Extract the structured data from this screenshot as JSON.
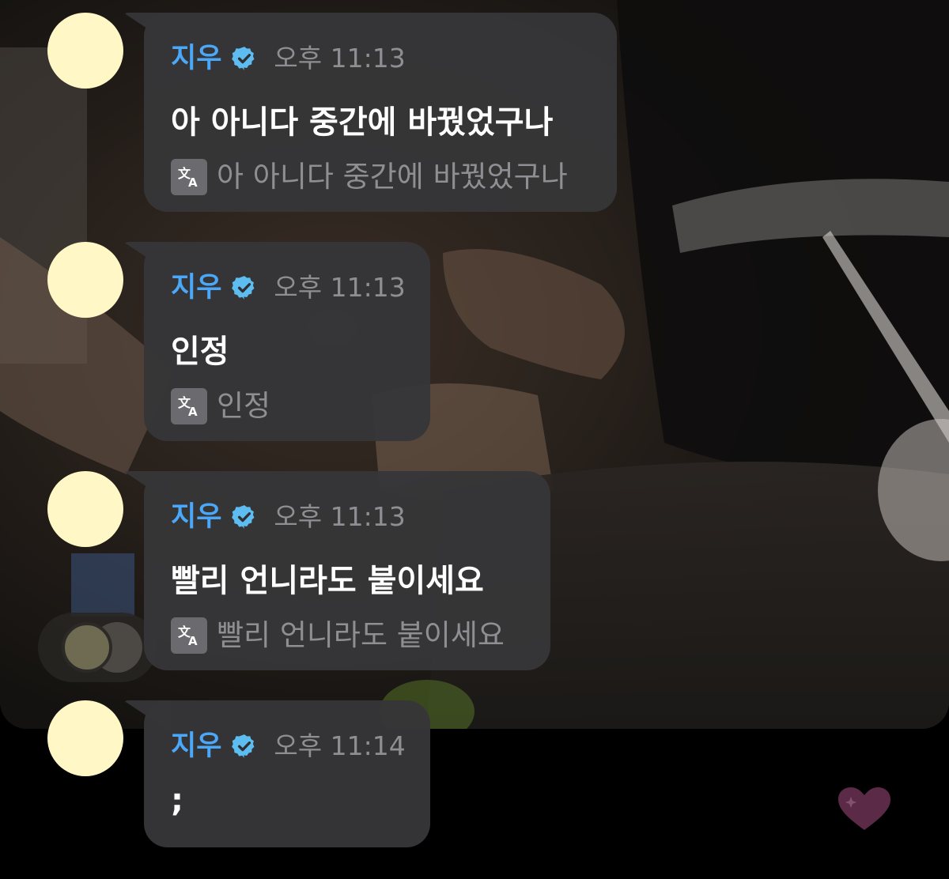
{
  "colors": {
    "sender": "#4ba7f7",
    "verified_badge": "#5dbdf0",
    "time": "#8e8e93",
    "bubble": "#363638",
    "avatar": "#fff8c6",
    "heart": "#5a2a47"
  },
  "messages": [
    {
      "sender": "지우",
      "time": "오후 11:13",
      "text": "아 아니다 중간에 바꿨었구나",
      "translation": "아 아니다 중간에 바꿨었구나"
    },
    {
      "sender": "지우",
      "time": "오후 11:13",
      "text": "인정",
      "translation": "인정"
    },
    {
      "sender": "지우",
      "time": "오후 11:13",
      "text": "빨리 언니라도 붙이세요",
      "translation": "빨리 언니라도 붙이세요"
    },
    {
      "sender": "지우",
      "time": "오후 11:14",
      "text": ";",
      "translation": ""
    }
  ],
  "icons": {
    "verified": "verified-badge-icon",
    "translate": "translate-icon",
    "heart": "heart-icon"
  }
}
